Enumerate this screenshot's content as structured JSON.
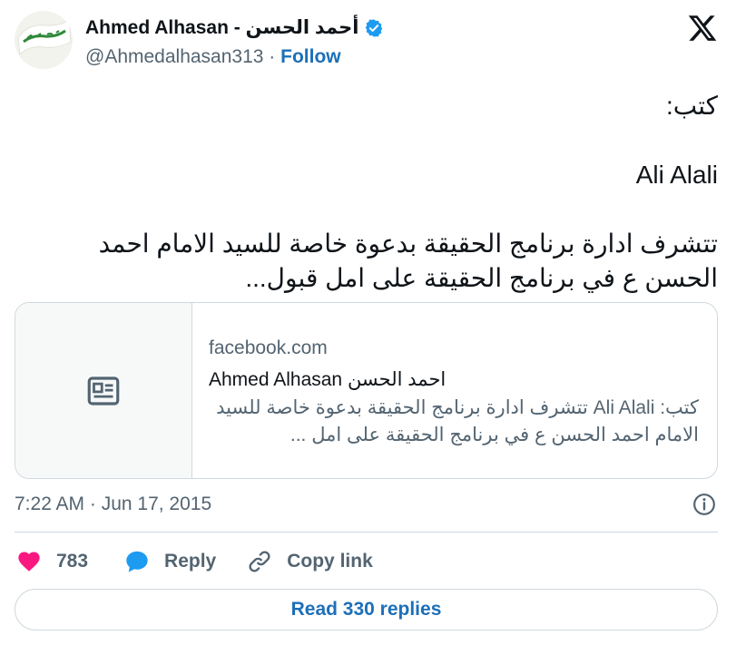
{
  "author": {
    "display_name": "Ahmed Alhasan - أحمد الحسن",
    "handle": "@Ahmedalhasan313",
    "separator": " · ",
    "follow_label": "Follow",
    "avatar_text": "البيعة لله",
    "verified": true
  },
  "tweet": {
    "line1": "كتب:",
    "line2": "Ali Alali",
    "line3": "تتشرف ادارة برنامج الحقيقة بدعوة خاصة للسيد الامام احمد الحسن ع في برنامج الحقيقة على امل قبول..."
  },
  "card": {
    "domain": "facebook.com",
    "title": "Ahmed Alhasan احمد الحسن",
    "description": "كتب: Ali Alali تتشرف ادارة برنامج الحقيقة بدعوة خاصة للسيد الامام احمد الحسن ع في برنامج الحقيقة على امل ..."
  },
  "meta": {
    "timestamp": "7:22 AM · Jun 17, 2015"
  },
  "actions": {
    "like_count": "783",
    "reply_label": "Reply",
    "copy_link_label": "Copy link"
  },
  "footer": {
    "read_replies_label": "Read 330 replies"
  },
  "colors": {
    "accent": "#1d6fb8",
    "like": "#f91880",
    "reply_icon": "#1d9bf0",
    "muted": "#536471",
    "border": "#cfd9de"
  },
  "icons": {
    "brand": "x-logo-icon",
    "verified": "verified-badge-icon",
    "card_thumb": "article-icon",
    "info": "info-icon",
    "like": "heart-icon",
    "reply": "speech-bubble-icon",
    "copy": "link-icon"
  }
}
